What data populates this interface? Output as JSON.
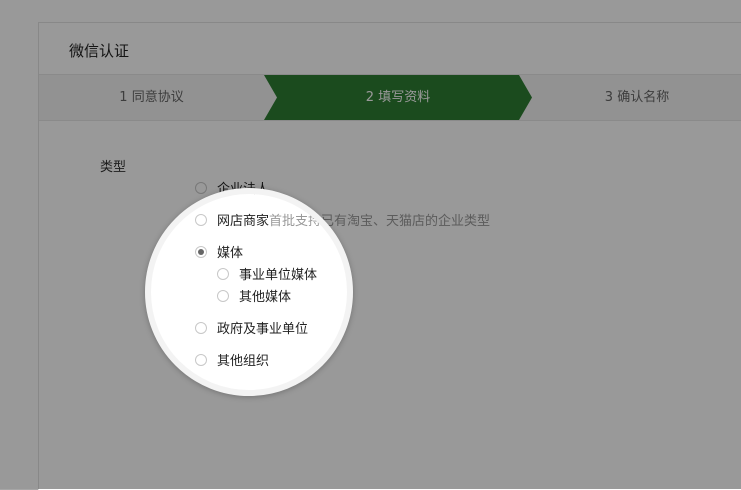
{
  "panel": {
    "title": "微信认证"
  },
  "steps": [
    {
      "label": "1 同意协议"
    },
    {
      "label": "2 填写资料"
    },
    {
      "label": "3 确认名称"
    }
  ],
  "form": {
    "type_label": "类型",
    "options": [
      {
        "label": "企业法人",
        "checked": false
      },
      {
        "label": "网店商家",
        "hint": "首批支持已有淘宝、天猫店的企业类型",
        "checked": false
      },
      {
        "label": "媒体",
        "checked": true
      },
      {
        "label": "事业单位媒体",
        "checked": false
      },
      {
        "label": "其他媒体",
        "checked": false
      },
      {
        "label": "政府及事业单位",
        "checked": false
      },
      {
        "label": "其他组织",
        "checked": false
      }
    ]
  },
  "colors": {
    "active_step": "#2e7d32",
    "overlay": "rgba(0,0,0,0.40)"
  }
}
